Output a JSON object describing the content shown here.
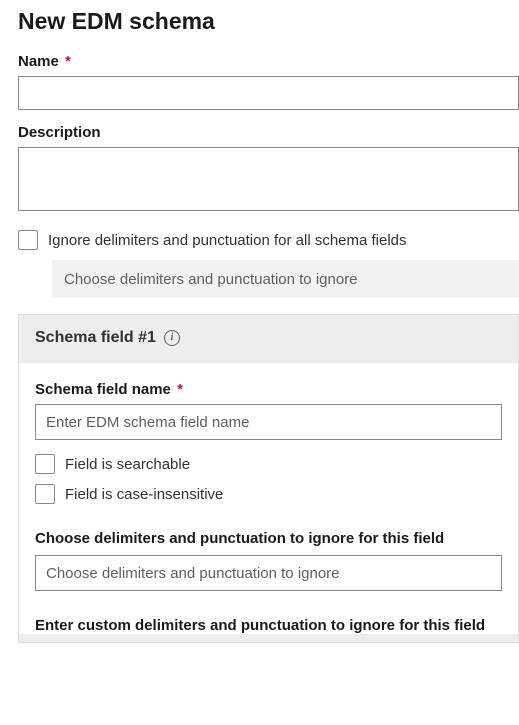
{
  "title": "New EDM schema",
  "name_field": {
    "label": "Name",
    "required": "*"
  },
  "description_field": {
    "label": "Description"
  },
  "ignore_all": {
    "label": "Ignore delimiters and punctuation for all schema fields",
    "placeholder": "Choose delimiters and punctuation to ignore"
  },
  "schema_field": {
    "header": "Schema field #1",
    "name_label": "Schema field name",
    "name_required": "*",
    "name_placeholder": "Enter EDM schema field name",
    "searchable_label": "Field is searchable",
    "case_insensitive_label": "Field is case-insensitive",
    "choose_delim_label": "Choose delimiters and punctuation to ignore for this field",
    "choose_delim_placeholder": "Choose delimiters and punctuation to ignore",
    "custom_delim_label": "Enter custom delimiters and punctuation to ignore for this field"
  }
}
